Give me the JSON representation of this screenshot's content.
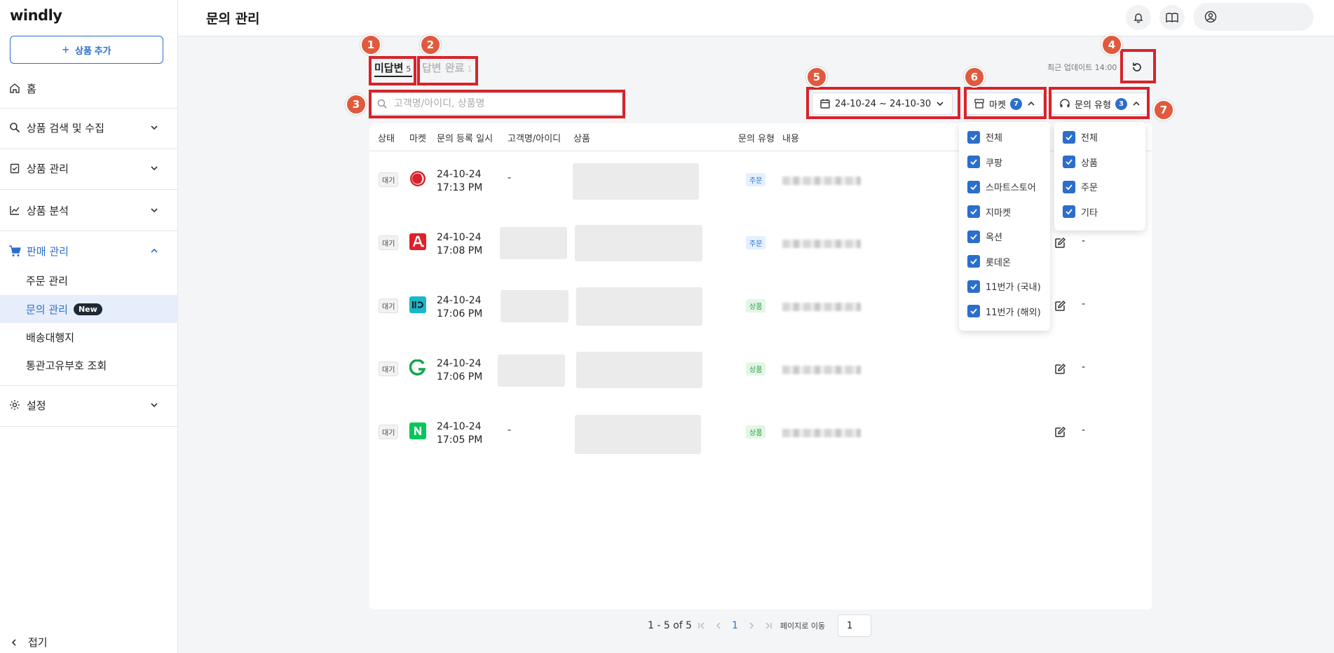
{
  "sidebar": {
    "logo": "windly",
    "add_product": "상품 추가",
    "home": "홈",
    "product_search": "상품 검색 및 수집",
    "product_manage": "상품 관리",
    "product_analysis": "상품 분석",
    "sales_manage": "판매 관리",
    "sub_items": [
      "주문 관리",
      "문의 관리",
      "배송대행지",
      "통관고유부호 조회"
    ],
    "new_badge": "New",
    "settings": "설정",
    "collapse": "접기"
  },
  "header": {
    "title": "문의 관리"
  },
  "tabs": [
    {
      "label": "미답변",
      "count": "5"
    },
    {
      "label": "답변 완료",
      "count": "1"
    }
  ],
  "last_updated": "최근 업데이트 14:00",
  "search": {
    "placeholder": "고객명/아이디, 상품명"
  },
  "filters": {
    "date_range": "24-10-24 ~ 24-10-30",
    "market_label": "마켓",
    "market_count": "7",
    "type_label": "문의 유형",
    "type_count": "3"
  },
  "table": {
    "columns": [
      "상태",
      "마켓",
      "문의 등록 일시",
      "고객명/아이디",
      "상품",
      "문의 유형",
      "내용"
    ],
    "rows": [
      {
        "status": "대기",
        "market_icon": "coupang-icon",
        "date": "24-10-24",
        "time": "17:13 PM",
        "customer": "-",
        "type": "주문",
        "reply": ""
      },
      {
        "status": "대기",
        "market_icon": "auction-icon",
        "date": "24-10-24",
        "time": "17:08 PM",
        "customer": "",
        "type": "주문",
        "reply": "-"
      },
      {
        "status": "대기",
        "market_icon": "11st-icon",
        "date": "24-10-24",
        "time": "17:06 PM",
        "customer": "",
        "type": "상품",
        "reply": "-"
      },
      {
        "status": "대기",
        "market_icon": "gmarket-icon",
        "date": "24-10-24",
        "time": "17:06 PM",
        "customer": "",
        "type": "상품",
        "reply": "-"
      },
      {
        "status": "대기",
        "market_icon": "naver-icon",
        "date": "24-10-24",
        "time": "17:05 PM",
        "customer": "-",
        "type": "상품",
        "reply": "-"
      }
    ]
  },
  "market_dropdown": [
    "전체",
    "쿠팡",
    "스마트스토어",
    "지마켓",
    "옥션",
    "롯데온",
    "11번가 (국내)",
    "11번가 (해외)"
  ],
  "type_dropdown": [
    "전체",
    "상품",
    "주문",
    "기타"
  ],
  "pagination": {
    "summary": "1 - 5 of 5",
    "current": "1",
    "goto_label": "페이지로 이동",
    "goto_value": "1"
  },
  "annotations": [
    "1",
    "2",
    "3",
    "4",
    "5",
    "6",
    "7"
  ],
  "colors": {
    "accent": "#2c6ecb",
    "annotation": "#d8232a",
    "marker": "#e05a3e"
  }
}
